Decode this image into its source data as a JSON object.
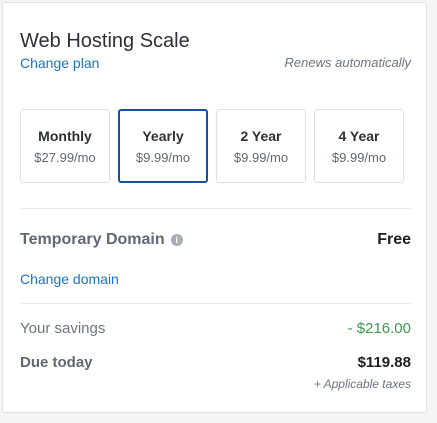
{
  "plan": {
    "title": "Web Hosting Scale",
    "change_label": "Change plan",
    "renews_text": "Renews automatically"
  },
  "billing_options": [
    {
      "name": "Monthly",
      "price": "$27.99/mo",
      "selected": false
    },
    {
      "name": "Yearly",
      "price": "$9.99/mo",
      "selected": true
    },
    {
      "name": "2 Year",
      "price": "$9.99/mo",
      "selected": false
    },
    {
      "name": "4 Year",
      "price": "$9.99/mo",
      "selected": false
    }
  ],
  "domain": {
    "label": "Temporary Domain",
    "info_icon": "info-icon",
    "value": "Free",
    "change_label": "Change domain"
  },
  "summary": {
    "savings_label": "Your savings",
    "savings_value": "- $216.00",
    "due_label": "Due today",
    "due_value": "$119.88",
    "taxes_note": "+ Applicable taxes"
  },
  "colors": {
    "link": "#1a73c4",
    "selected_border": "#1a4f9c",
    "savings": "#3a9b4a"
  }
}
